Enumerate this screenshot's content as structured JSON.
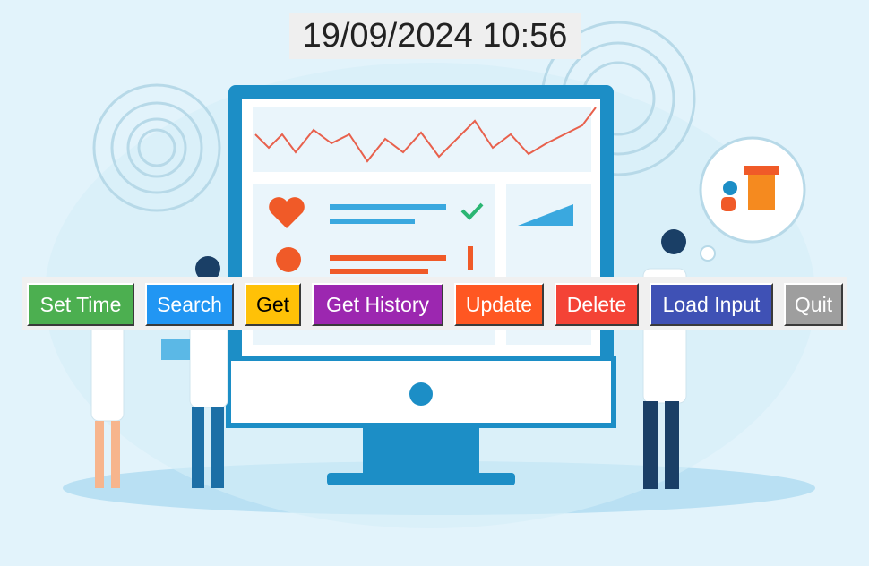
{
  "clock": {
    "datetime": "19/09/2024 10:56"
  },
  "toolbar": {
    "buttons": [
      {
        "id": "set-time",
        "label": "Set Time",
        "color": "#4caf50",
        "text_color": "#ffffff"
      },
      {
        "id": "search",
        "label": "Search",
        "color": "#2196f3",
        "text_color": "#ffffff"
      },
      {
        "id": "get",
        "label": "Get",
        "color": "#ffc107",
        "text_color": "#000000"
      },
      {
        "id": "get-history",
        "label": "Get History",
        "color": "#9c27b0",
        "text_color": "#ffffff"
      },
      {
        "id": "update",
        "label": "Update",
        "color": "#ff5722",
        "text_color": "#ffffff"
      },
      {
        "id": "delete",
        "label": "Delete",
        "color": "#f44336",
        "text_color": "#ffffff"
      },
      {
        "id": "load-input",
        "label": "Load Input",
        "color": "#3f51b5",
        "text_color": "#ffffff"
      },
      {
        "id": "quit",
        "label": "Quit",
        "color": "#9e9e9e",
        "text_color": "#ffffff"
      }
    ]
  },
  "colors": {
    "background": "#e2f3fb",
    "monitor_frame": "#1c8ec6",
    "chart_line": "#e8604c",
    "accent_orange": "#f05a28"
  }
}
